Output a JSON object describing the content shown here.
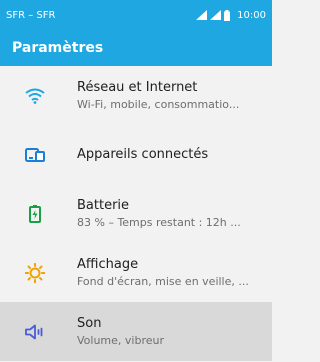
{
  "status_bar": {
    "carrier": "SFR – SFR",
    "time": "10:00",
    "icons": [
      "signal-icon",
      "signal-icon",
      "battery-icon"
    ]
  },
  "app_bar": {
    "title": "Paramètres"
  },
  "colors": {
    "accent": "#1ea7e0",
    "network_icon": "#1ea7e0",
    "devices_icon": "#1a7fd6",
    "battery_icon": "#18a046",
    "display_icon": "#f2a200",
    "sound_icon": "#4a5bd8",
    "selected_bg": "#d9d9d9"
  },
  "settings": [
    {
      "title": "Réseau et Internet",
      "subtitle": "Wi-Fi, mobile, consommatio...",
      "icon": "wifi-icon"
    },
    {
      "title": "Appareils connectés",
      "subtitle": "",
      "icon": "devices-icon"
    },
    {
      "title": "Batterie",
      "subtitle": "83 % – Temps restant : 12h ...",
      "icon": "battery-charging-icon"
    },
    {
      "title": "Affichage",
      "subtitle": "Fond d'écran, mise en veille, ...",
      "icon": "brightness-icon"
    },
    {
      "title": "Son",
      "subtitle": "Volume, vibreur",
      "icon": "volume-icon",
      "selected": true
    }
  ]
}
